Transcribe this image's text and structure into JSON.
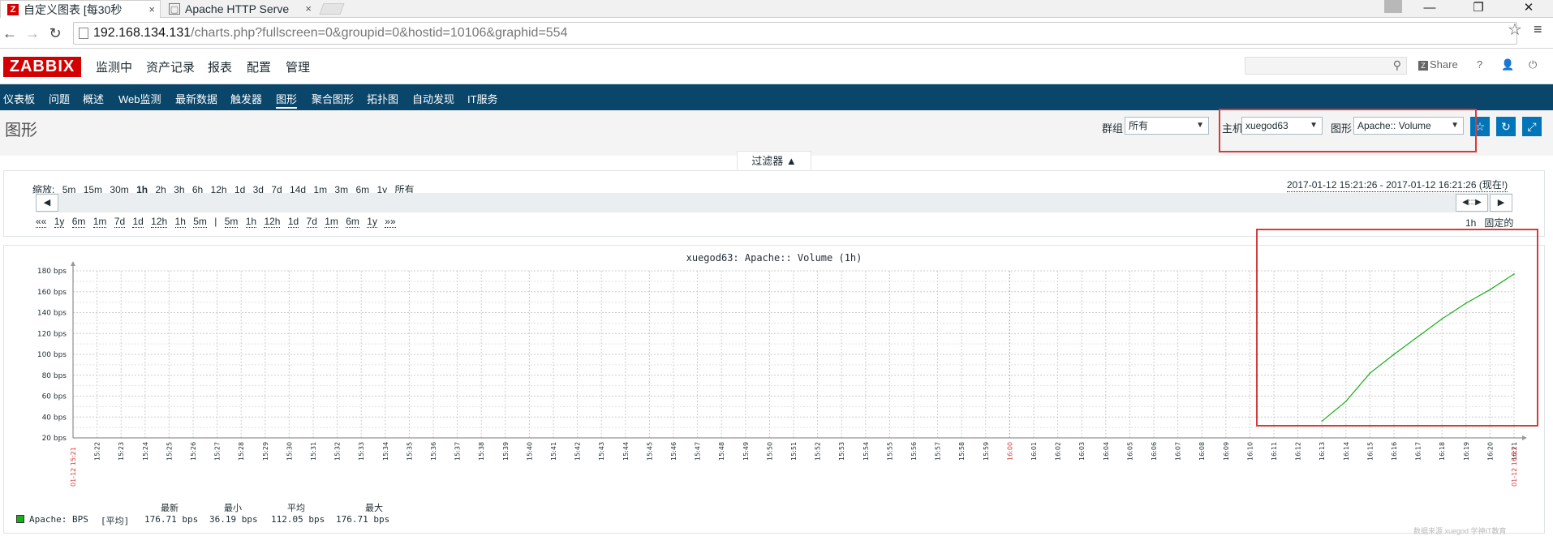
{
  "browser": {
    "tabs": [
      {
        "title": "自定义图表 [每30秒",
        "icon": "zabbix-favicon"
      },
      {
        "title": "Apache HTTP Serve",
        "icon": "page-favicon"
      }
    ],
    "url_host": "192.168.134.131",
    "url_path": "/charts.php?fullscreen=0&groupid=0&hostid=10106&graphid=554"
  },
  "header": {
    "logo": "ZABBIX",
    "menu": [
      "监测中",
      "资产记录",
      "报表",
      "配置",
      "管理"
    ],
    "search_placeholder": "",
    "share_label": "Share",
    "help_label": "?"
  },
  "subnav": [
    "仪表板",
    "问题",
    "概述",
    "Web监测",
    "最新数据",
    "触发器",
    "图形",
    "聚合图形",
    "拓扑图",
    "自动发现",
    "IT服务"
  ],
  "page": {
    "title": "图形",
    "group_label": "群组",
    "group_value": "所有",
    "host_label": "主机",
    "host_value": "xuegod63",
    "graph_label": "图形",
    "graph_value": "Apache:: Volume"
  },
  "filter": {
    "tab_label": "过滤器 ▲",
    "zoom_label": "缩放:",
    "zoom_options": [
      "5m",
      "15m",
      "30m",
      "1h",
      "2h",
      "3h",
      "6h",
      "12h",
      "1d",
      "3d",
      "7d",
      "14d",
      "1m",
      "3m",
      "6m",
      "1y",
      "所有"
    ],
    "zoom_current": "1h",
    "time_range": "2017-01-12 15:21:26 - 2017-01-12 16:21:26 (现在!)",
    "nav_left": [
      "««",
      "1y",
      "6m",
      "1m",
      "7d",
      "1d",
      "12h",
      "1h",
      "5m",
      "|"
    ],
    "nav_right": [
      "5m",
      "1h",
      "12h",
      "1d",
      "7d",
      "1m",
      "6m",
      "1y",
      "»»"
    ],
    "period_label": "1h",
    "fixed_label": "固定的"
  },
  "chart_data": {
    "type": "line",
    "title": "xuegod63: Apache:: Volume (1h)",
    "y_unit": "bps",
    "ylim": [
      20,
      180
    ],
    "yticks": [
      "20 bps",
      "40 bps",
      "60 bps",
      "80 bps",
      "100 bps",
      "120 bps",
      "140 bps",
      "160 bps",
      "180 bps"
    ],
    "x_start_label": "01-12 15:21",
    "x_end_label": "01-12 16:21",
    "x_ticks": [
      "15:22",
      "15:23",
      "15:24",
      "15:25",
      "15:26",
      "15:27",
      "15:28",
      "15:29",
      "15:30",
      "15:31",
      "15:32",
      "15:33",
      "15:34",
      "15:35",
      "15:36",
      "15:37",
      "15:38",
      "15:39",
      "15:40",
      "15:41",
      "15:42",
      "15:43",
      "15:44",
      "15:45",
      "15:46",
      "15:47",
      "15:48",
      "15:49",
      "15:50",
      "15:51",
      "15:52",
      "15:53",
      "15:54",
      "15:55",
      "15:56",
      "15:57",
      "15:58",
      "15:59",
      "16:00",
      "16:01",
      "16:02",
      "16:03",
      "16:04",
      "16:05",
      "16:06",
      "16:07",
      "16:08",
      "16:09",
      "16:10",
      "16:11",
      "16:12",
      "16:13",
      "16:14",
      "16:15",
      "16:16",
      "16:17",
      "16:18",
      "16:19",
      "16:20",
      "16:21"
    ],
    "highlight_tick": "16:00",
    "grid": true,
    "series": [
      {
        "name": "Apache: BPS",
        "color": "#1aaf1a",
        "x": [
          "16:13",
          "16:14",
          "16:15",
          "16:16",
          "16:17",
          "16:18",
          "16:19",
          "16:20",
          "16:21"
        ],
        "values": [
          36,
          55,
          82,
          100,
          117,
          134,
          149,
          162,
          177
        ]
      }
    ],
    "legend": {
      "series_name": "Apache: BPS",
      "func": "[平均]",
      "headers": [
        "最新",
        "最小",
        "平均",
        "最大"
      ],
      "values": [
        "176.71 bps",
        "36.19 bps",
        "112.05 bps",
        "176.71 bps"
      ]
    }
  },
  "watermark": "数据来源 xuegod 学神IT教育"
}
